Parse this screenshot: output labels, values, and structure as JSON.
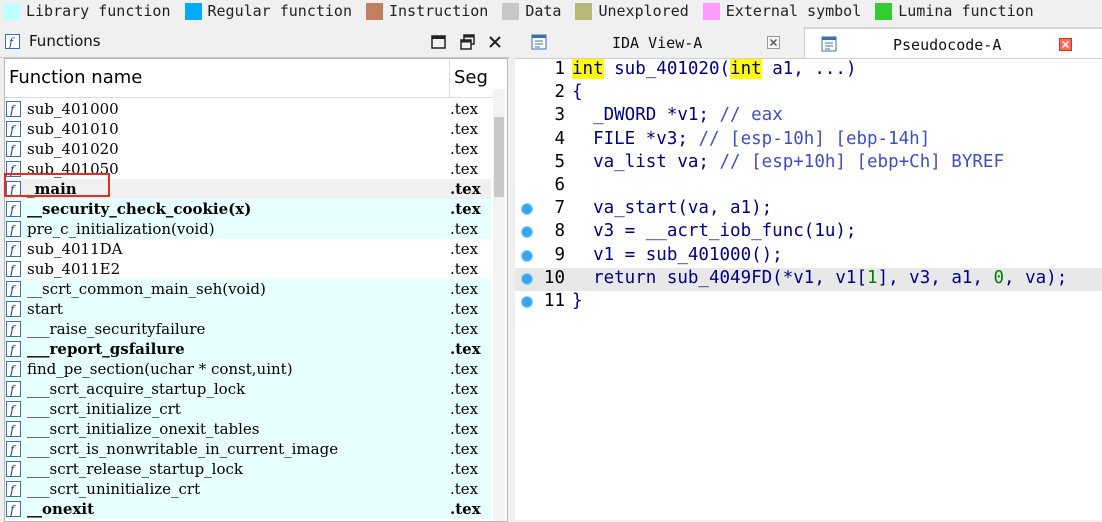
{
  "legend": [
    {
      "label": "Library function",
      "color": "#c0ffff"
    },
    {
      "label": "Regular function",
      "color": "#00aaff"
    },
    {
      "label": "Instruction",
      "color": "#c08060"
    },
    {
      "label": "Data",
      "color": "#c8c8c8"
    },
    {
      "label": "Unexplored",
      "color": "#b8b878"
    },
    {
      "label": "External symbol",
      "color": "#ff9cff"
    },
    {
      "label": "Lumina function",
      "color": "#33cc33"
    }
  ],
  "functions_panel": {
    "title": "Functions",
    "col_name": "Function name",
    "col_segment": "Seg",
    "rows": [
      {
        "name": "sub_401000",
        "seg": ".tex",
        "type": "regular",
        "bold": false
      },
      {
        "name": "sub_401010",
        "seg": ".tex",
        "type": "regular",
        "bold": false
      },
      {
        "name": "sub_401020",
        "seg": ".tex",
        "type": "regular",
        "bold": false
      },
      {
        "name": "sub_401050",
        "seg": ".tex",
        "type": "regular",
        "bold": false
      },
      {
        "name": "_main",
        "seg": ".tex",
        "type": "selected",
        "bold": true
      },
      {
        "name": "__security_check_cookie(x)",
        "seg": ".tex",
        "type": "library",
        "bold": true
      },
      {
        "name": "pre_c_initialization(void)",
        "seg": ".tex",
        "type": "library",
        "bold": false
      },
      {
        "name": "sub_4011DA",
        "seg": ".tex",
        "type": "regular",
        "bold": false
      },
      {
        "name": "sub_4011E2",
        "seg": ".tex",
        "type": "regular",
        "bold": false
      },
      {
        "name": "__scrt_common_main_seh(void)",
        "seg": ".tex",
        "type": "library",
        "bold": false
      },
      {
        "name": "start",
        "seg": ".tex",
        "type": "library",
        "bold": false
      },
      {
        "name": "___raise_securityfailure",
        "seg": ".tex",
        "type": "library",
        "bold": false
      },
      {
        "name": "___report_gsfailure",
        "seg": ".tex",
        "type": "library",
        "bold": true
      },
      {
        "name": "find_pe_section(uchar * const,uint)",
        "seg": ".tex",
        "type": "library",
        "bold": false
      },
      {
        "name": "___scrt_acquire_startup_lock",
        "seg": ".tex",
        "type": "library",
        "bold": false
      },
      {
        "name": "___scrt_initialize_crt",
        "seg": ".tex",
        "type": "library",
        "bold": false
      },
      {
        "name": "___scrt_initialize_onexit_tables",
        "seg": ".tex",
        "type": "library",
        "bold": false
      },
      {
        "name": "___scrt_is_nonwritable_in_current_image",
        "seg": ".tex",
        "type": "library",
        "bold": false
      },
      {
        "name": "___scrt_release_startup_lock",
        "seg": ".tex",
        "type": "library",
        "bold": false
      },
      {
        "name": "___scrt_uninitialize_crt",
        "seg": ".tex",
        "type": "library",
        "bold": false
      },
      {
        "name": "__onexit",
        "seg": ".tex",
        "type": "library",
        "bold": true
      }
    ]
  },
  "tabs": [
    {
      "label": "IDA View-A",
      "active": false
    },
    {
      "label": "Pseudocode-A",
      "active": true
    }
  ],
  "pseudocode": {
    "lines": [
      {
        "num": "1",
        "dot": false,
        "highlight": false,
        "text": "int sub_401020(int a1, ...)"
      },
      {
        "num": "2",
        "dot": false,
        "highlight": false,
        "text": "{"
      },
      {
        "num": "3",
        "dot": false,
        "highlight": false,
        "text": "  _DWORD *v1; // eax"
      },
      {
        "num": "4",
        "dot": false,
        "highlight": false,
        "text": "  FILE *v3; // [esp-10h] [ebp-14h]"
      },
      {
        "num": "5",
        "dot": false,
        "highlight": false,
        "text": "  va_list va; // [esp+10h] [ebp+Ch] BYREF"
      },
      {
        "num": "6",
        "dot": false,
        "highlight": false,
        "text": ""
      },
      {
        "num": "7",
        "dot": true,
        "highlight": false,
        "text": "  va_start(va, a1);"
      },
      {
        "num": "8",
        "dot": true,
        "highlight": false,
        "text": "  v3 = __acrt_iob_func(1u);"
      },
      {
        "num": "9",
        "dot": true,
        "highlight": false,
        "text": "  v1 = sub_401000();"
      },
      {
        "num": "10",
        "dot": true,
        "highlight": true,
        "text": "  return sub_4049FD(*v1, v1[1], v3, a1, 0, va);"
      },
      {
        "num": "11",
        "dot": true,
        "highlight": false,
        "text": "}"
      }
    ]
  }
}
